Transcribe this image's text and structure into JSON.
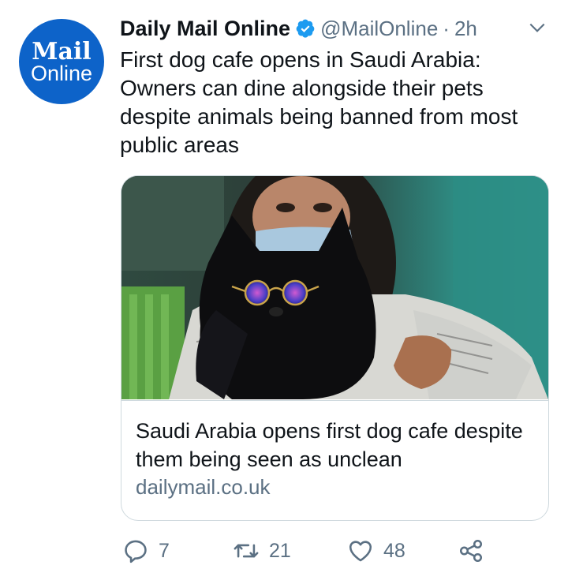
{
  "avatar": {
    "line1": "Mail",
    "line2": "Online",
    "color": "#0d63c9"
  },
  "tweet": {
    "display_name": "Daily Mail Online",
    "handle": "@MailOnline",
    "separator": "·",
    "time": "2h",
    "text": "First dog cafe opens in Saudi Arabia: Owners can dine alongside their pets despite animals being banned from most public areas"
  },
  "card": {
    "title": "Saudi Arabia opens first dog cafe despite them being seen as unclean",
    "domain": "dailymail.co.uk",
    "image_alt": "woman in face mask holding a black dog wearing round sunglasses"
  },
  "actions": {
    "replies": "7",
    "retweets": "21",
    "likes": "48"
  },
  "icons": {
    "verified": "verified-badge-icon",
    "more": "chevron-down-icon",
    "reply": "reply-icon",
    "retweet": "retweet-icon",
    "like": "heart-icon",
    "share": "share-icon"
  },
  "colors": {
    "accent": "#1d9bf0",
    "secondary_text": "#5b7083",
    "border": "#cfd9de"
  }
}
